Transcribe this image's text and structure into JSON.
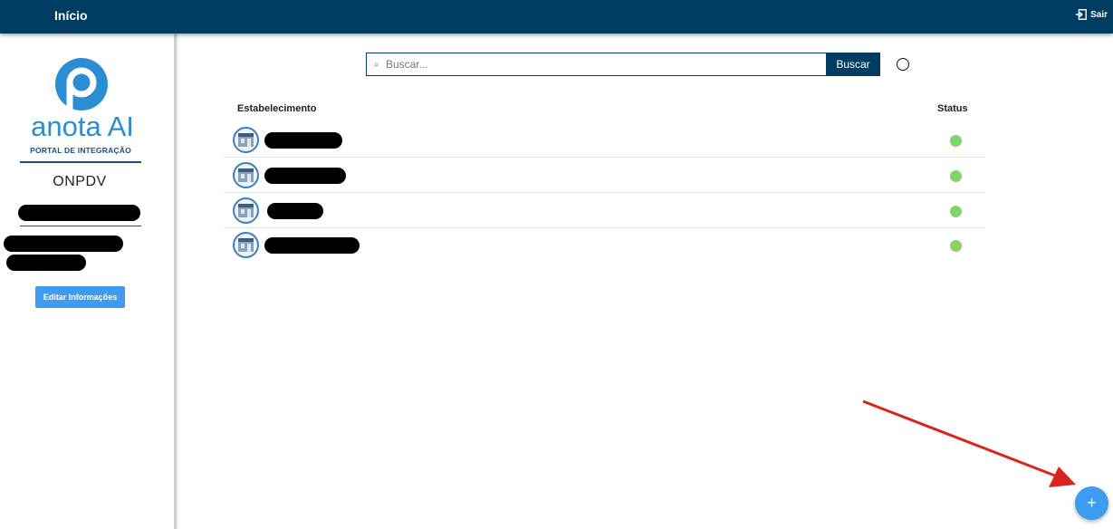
{
  "topbar": {
    "title": "Início",
    "logout_label": "Sair",
    "logout_icon": "logout-icon"
  },
  "sidebar": {
    "logo_text": "anota AI",
    "logo_subtitle": "PORTAL DE INTEGRAÇÃO",
    "company_name": "ONPDV",
    "edit_button_label": "Editar Informações"
  },
  "search": {
    "placeholder": " Buscar...",
    "button_label": "Buscar",
    "icon": "search-icon"
  },
  "table": {
    "headers": {
      "name": "Estabelecimento",
      "status": "Status"
    },
    "rows": [
      {
        "status": "active"
      },
      {
        "status": "active"
      },
      {
        "status": "active"
      },
      {
        "status": "active"
      }
    ]
  },
  "fab": {
    "label": "+"
  },
  "colors": {
    "topbar": "#003d63",
    "accent": "#3d9bf0",
    "status_active": "#7fd46c",
    "annotation_arrow": "#d9261c"
  }
}
